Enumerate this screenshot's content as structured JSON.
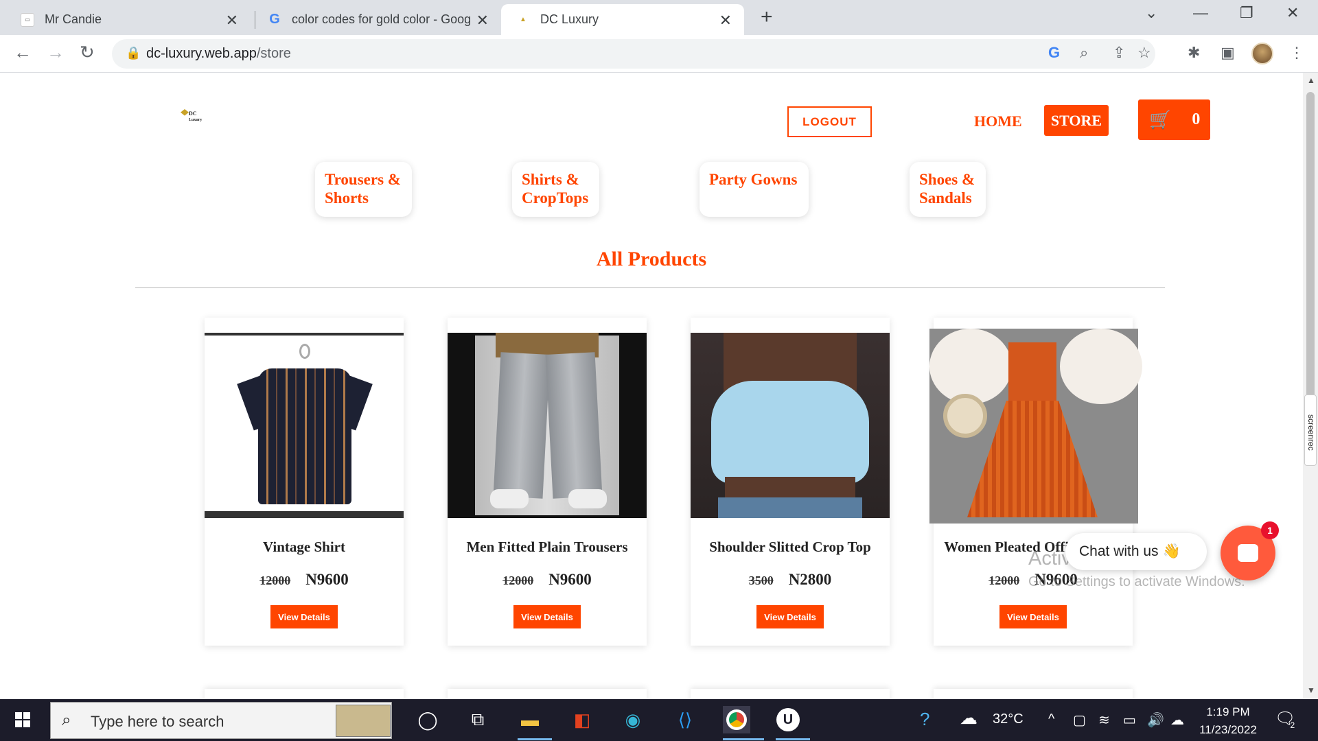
{
  "browser": {
    "tabs": [
      {
        "title": "Mr Candie",
        "favicon": "page-icon"
      },
      {
        "title": "color codes for gold color - Goog",
        "favicon": "google-icon"
      },
      {
        "title": "DC Luxury",
        "favicon": "dc-icon"
      }
    ],
    "url_domain": "dc-luxury.web.app",
    "url_path": "/store"
  },
  "site": {
    "logo_text_1": "DC",
    "logo_text_2": "Luxury",
    "logout_label": "LOGOUT",
    "home_label": "HOME",
    "store_label": "STORE",
    "cart_count": "0",
    "brand_color": "#ff4500"
  },
  "categories": [
    {
      "label": "Trousers & Shorts"
    },
    {
      "label": "Shirts & CropTops"
    },
    {
      "label": "Party Gowns"
    },
    {
      "label": "Shoes & Sandals"
    }
  ],
  "section_title": "All Products",
  "products": [
    {
      "name": "Vintage Shirt",
      "old_price": "12000",
      "price": "N9600",
      "button": "View Details"
    },
    {
      "name": "Men Fitted Plain Trousers",
      "old_price": "12000",
      "price": "N9600",
      "button": "View Details"
    },
    {
      "name": "Shoulder Slitted Crop Top",
      "old_price": "3500",
      "price": "N2800",
      "button": "View Details"
    },
    {
      "name": "Women Pleated Office Gown",
      "old_price": "12000",
      "price": "N9600",
      "button": "View Details"
    }
  ],
  "chat": {
    "label": "Chat with us",
    "emoji": "👋",
    "badge": "1"
  },
  "watermark": {
    "line1": "Activate Windows",
    "line2": "Go to Settings to activate Windows."
  },
  "screenrec_label": "screenrec",
  "taskbar": {
    "search_placeholder": "Type here to search",
    "weather": "32°C",
    "time": "1:19 PM",
    "date": "11/23/2022",
    "notification_count": "2"
  }
}
